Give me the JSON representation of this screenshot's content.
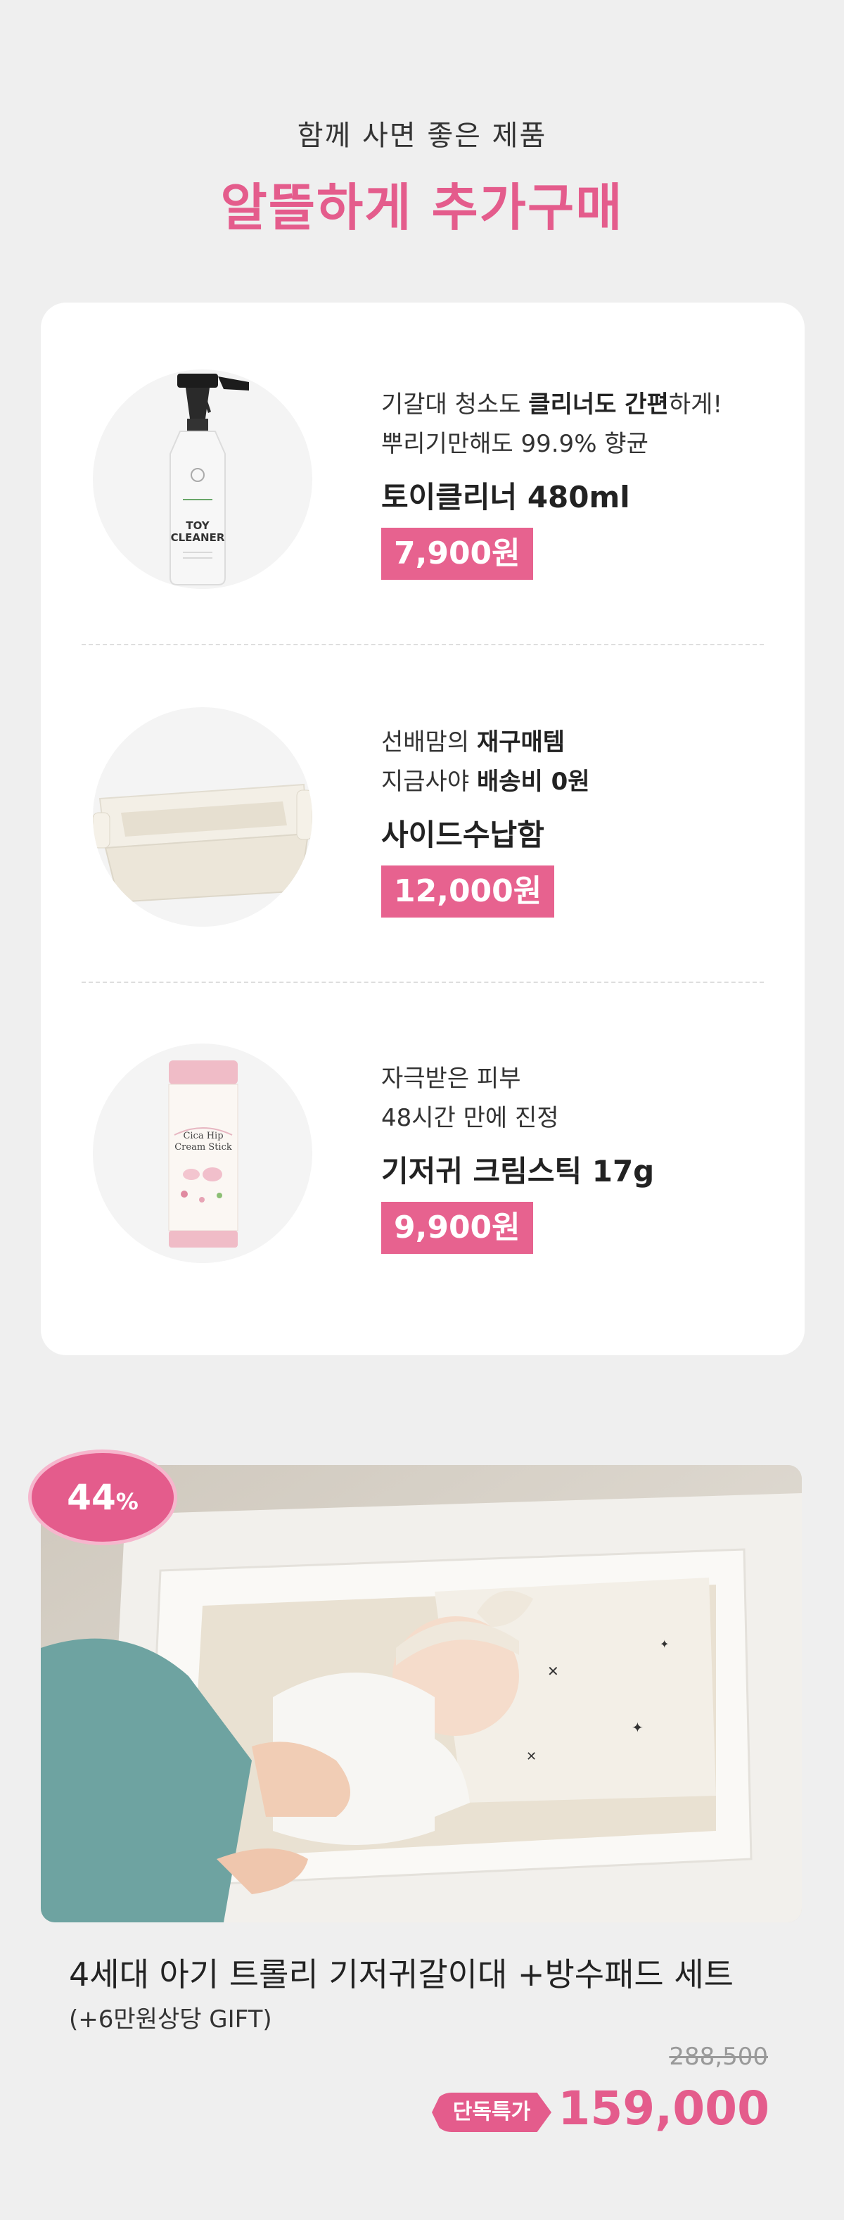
{
  "header": {
    "subtitle": "함께 사면 좋은 제품",
    "title": "알뜰하게 추가구매"
  },
  "products": [
    {
      "desc1_pre": "기갈대 청소도 ",
      "desc1_bold": "클리너도 간편",
      "desc1_post": "하게!",
      "desc2": "뿌리기만해도 99.9% 향균",
      "name": "토이클리너 480ml",
      "price": "7,900원",
      "image_label_1": "TOY",
      "image_label_2": "CLEANER"
    },
    {
      "desc1_pre": "선배맘의 ",
      "desc1_bold": "재구매템",
      "desc2_pre": "지금사야 ",
      "desc2_bold": "배송비 0원",
      "name": "사이드수납함",
      "price": "12,000원"
    },
    {
      "desc1": "자극받은 피부",
      "desc2": "48시간 만에 진정",
      "name": "기저귀 크림스틱 17g",
      "price": "9,900원",
      "image_label_1": "Cica Hip",
      "image_label_2": "Cream Stick"
    }
  ],
  "main_product": {
    "discount_num": "44",
    "discount_unit": "%",
    "title": "4세대 아기 트롤리 기저귀갈이대 +방수패드 세트",
    "gift": "(+6만원상당 GIFT)",
    "original_price": "288,500",
    "special_tag": "단독특가",
    "sale_price": "159,000"
  },
  "colors": {
    "accent": "#e45c8c",
    "price_bg": "#e7628f",
    "background": "#efefef"
  }
}
